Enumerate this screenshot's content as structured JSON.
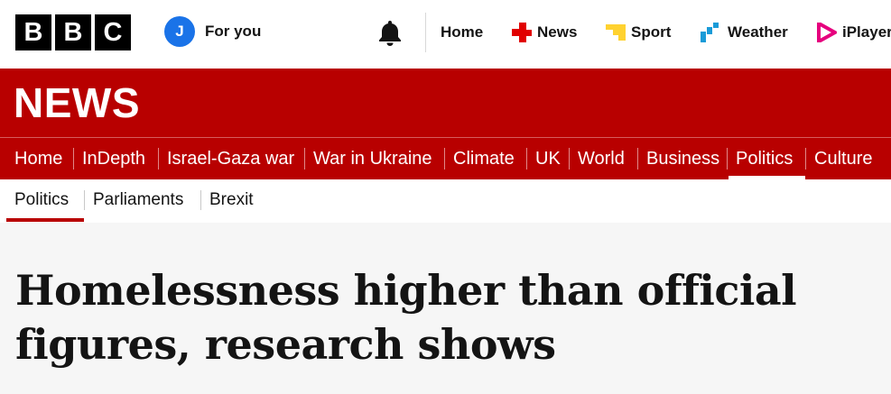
{
  "masthead": {
    "logo_letters": [
      "B",
      "B",
      "C"
    ],
    "account": {
      "initial": "J",
      "label": "For you",
      "avatar_color": "#1a73e8"
    },
    "top_nav": [
      {
        "label": "Home",
        "icon": null
      },
      {
        "label": "News",
        "icon": "news-icon",
        "icon_color": "#e10000"
      },
      {
        "label": "Sport",
        "icon": "sport-icon",
        "icon_color": "#ffd230"
      },
      {
        "label": "Weather",
        "icon": "weather-icon",
        "icon_color": "#1a9bd8"
      },
      {
        "label": "iPlayer",
        "icon": "iplayer-icon",
        "icon_color": "#e6007e"
      }
    ]
  },
  "section": {
    "title": "NEWS",
    "brand_color": "#b80000"
  },
  "main_nav": {
    "items": [
      "Home",
      "InDepth",
      "Israel-Gaza war",
      "War in Ukraine",
      "Climate",
      "UK",
      "World",
      "Business",
      "Politics",
      "Culture"
    ],
    "active": "Politics"
  },
  "sub_nav": {
    "items": [
      "Politics",
      "Parliaments",
      "Brexit"
    ],
    "active": "Politics"
  },
  "article": {
    "headline": "Homelessness higher than official figures, research shows"
  }
}
